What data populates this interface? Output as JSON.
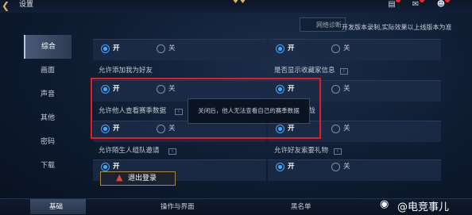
{
  "header": {
    "title": "设置",
    "diagnose_label": "网络诊断",
    "notice": "开发版本录制,实际效果以上线版本为准"
  },
  "sidebar": {
    "items": [
      {
        "label": "综合",
        "active": true
      },
      {
        "label": "画面",
        "active": false
      },
      {
        "label": "声音",
        "active": false
      },
      {
        "label": "其他",
        "active": false
      },
      {
        "label": "密码",
        "active": false
      },
      {
        "label": "下载",
        "active": false
      }
    ]
  },
  "settings": {
    "on_label": "开",
    "off_label": "关",
    "rows": [
      {
        "left_label": "",
        "right_label": ""
      },
      {
        "left_label": "允许添加我为好友",
        "right_label": "是否显示收藏家信息"
      },
      {
        "left_label": "允许他人查看赛季数据",
        "right_label": "战"
      },
      {
        "left_label": "允许陌生人组队邀请",
        "right_label": "允许好友索要礼物"
      }
    ]
  },
  "tooltip": {
    "text": "关闭后，他人无法查看自己的赛季数据"
  },
  "logout": {
    "label": "退出登录"
  },
  "bottom_tabs": [
    {
      "label": "基础",
      "active": true
    },
    {
      "label": "操作与界面",
      "active": false
    },
    {
      "label": "黑名单",
      "active": false
    }
  ],
  "watermark": {
    "text": "@电竞事儿"
  },
  "colors": {
    "accent": "#3fa7ff",
    "highlight": "#e21e26",
    "gold": "#d9b766"
  },
  "icons": {
    "back": "back-arrow-icon",
    "crown": "crown-icon",
    "record": "record-icon",
    "chat": "chat-icon",
    "friends": "friends-icon",
    "warning": "warning-icon"
  }
}
